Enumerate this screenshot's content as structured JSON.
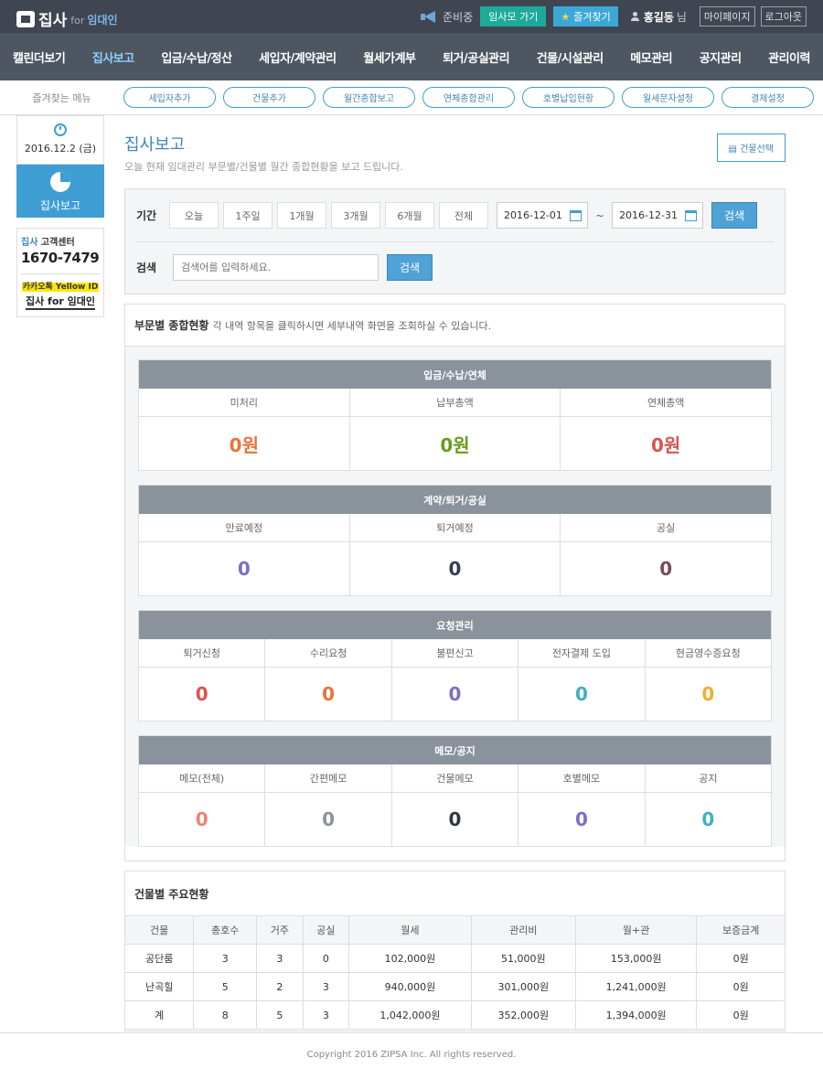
{
  "brand": {
    "name": "집사",
    "for": "for",
    "target": "임대인"
  },
  "topbar": {
    "notice": "준비중",
    "go_btn": "임사모 가기",
    "fav_btn": "즐겨찾기",
    "user": "홍길동",
    "suffix": "님",
    "mypage": "마이페이지",
    "logout": "로그아웃"
  },
  "nav": [
    "캘린더보기",
    "집사보고",
    "입금/수납/정산",
    "세입자/계약관리",
    "월세가계부",
    "퇴거/공실관리",
    "건물/시설관리",
    "메모관리",
    "공지관리",
    "관리이력"
  ],
  "fav": {
    "label": "즐겨찾는 메뉴",
    "items": [
      "세입자추가",
      "건물추가",
      "월간종합보고",
      "연체종합관리",
      "호별납입현황",
      "월세문자설정",
      "결제설정"
    ]
  },
  "sidebar": {
    "date": "2016.12.2 (금)",
    "current": "집사보고",
    "cs_title_brand": "집사",
    "cs_title": "고객센터",
    "cs_phone": "1670-7479",
    "kakao_label": "카카오톡 Yellow ID",
    "kakao_name": "집사 for 임대인"
  },
  "page": {
    "title": "집사보고",
    "subtitle": "오늘 현재 임대관리 부문별/건물별 월간 종합현황을 보고 드립니다.",
    "building_select": "건물선택"
  },
  "filter": {
    "period_label": "기간",
    "ranges": [
      "오늘",
      "1주일",
      "1개월",
      "3개월",
      "6개월",
      "전체"
    ],
    "start": "2016-12-01",
    "tilde": "~",
    "end": "2016-12-31",
    "search_btn": "검색",
    "search_label": "검색",
    "search_placeholder": "검색어를 입력하세요.",
    "search_btn2": "검색"
  },
  "summary": {
    "title": "부문별 종합현황",
    "desc": "각 내역 항목을 클릭하시면 세부내역 화면을 조회하실 수 있습니다.",
    "groups": [
      {
        "title": "입금/수납/연체",
        "items": [
          {
            "label": "미처리",
            "value": "0원",
            "color": "#e8743b"
          },
          {
            "label": "납부총액",
            "value": "0원",
            "color": "#6a9a1f"
          },
          {
            "label": "연체총액",
            "value": "0원",
            "color": "#d9534f"
          }
        ]
      },
      {
        "title": "계약/퇴거/공실",
        "items": [
          {
            "label": "만료예정",
            "value": "0",
            "color": "#7b6fc6"
          },
          {
            "label": "퇴거예정",
            "value": "0",
            "color": "#333f4f"
          },
          {
            "label": "공실",
            "value": "0",
            "color": "#7a4a5a"
          }
        ]
      },
      {
        "title": "요청관리",
        "items": [
          {
            "label": "퇴거신청",
            "value": "0",
            "color": "#d9534f"
          },
          {
            "label": "수리요청",
            "value": "0",
            "color": "#e8743b"
          },
          {
            "label": "불편신고",
            "value": "0",
            "color": "#7b6fc6"
          },
          {
            "label": "전자결제 도입",
            "value": "0",
            "color": "#3fb0c8"
          },
          {
            "label": "현금영수증요청",
            "value": "0",
            "color": "#f0ad2e"
          }
        ]
      },
      {
        "title": "메모/공지",
        "items": [
          {
            "label": "메모(전체)",
            "value": "0",
            "color": "#e8847a"
          },
          {
            "label": "간편메모",
            "value": "0",
            "color": "#8a939c"
          },
          {
            "label": "건물메모",
            "value": "0",
            "color": "#2e3744"
          },
          {
            "label": "호별메모",
            "value": "0",
            "color": "#7b6fc6"
          },
          {
            "label": "공지",
            "value": "0",
            "color": "#3fb0c8"
          }
        ]
      }
    ]
  },
  "buildings": {
    "title": "건물별 주요현황",
    "headers": [
      "건물",
      "총호수",
      "거주",
      "공실",
      "월세",
      "관리비",
      "월+관",
      "보증금계"
    ],
    "rows": [
      [
        "공단룸",
        "3",
        "3",
        "0",
        "102,000원",
        "51,000원",
        "153,000원",
        "0원"
      ],
      [
        "난곡힐",
        "5",
        "2",
        "3",
        "940,000원",
        "301,000원",
        "1,241,000원",
        "0원"
      ],
      [
        "계",
        "8",
        "5",
        "3",
        "1,042,000원",
        "352,000원",
        "1,394,000원",
        "0원"
      ]
    ]
  },
  "footer": "Copyright 2016 ZIPSA Inc. All rights reserved."
}
